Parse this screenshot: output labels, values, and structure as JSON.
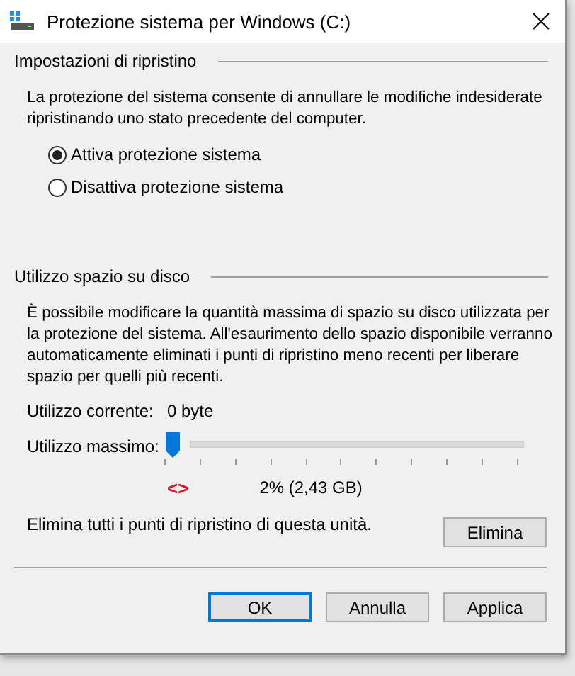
{
  "window": {
    "title": "Protezione sistema per Windows (C:)"
  },
  "restore_settings": {
    "heading": "Impostazioni di ripristino",
    "description": "La protezione del sistema consente di annullare le modifiche indesiderate ripristinando uno stato precedente del computer.",
    "options": [
      {
        "label": "Attiva protezione sistema",
        "selected": true
      },
      {
        "label": "Disattiva protezione sistema",
        "selected": false
      }
    ]
  },
  "disk_usage": {
    "heading": "Utilizzo spazio su disco",
    "description": "È possibile modificare la quantità massima di spazio su disco utilizzata per la protezione del sistema. All'esaurimento dello spazio disponibile verranno automaticamente eliminati i punti di ripristino meno recenti per liberare spazio per quelli più recenti.",
    "current_label": "Utilizzo corrente:",
    "current_value": "0 byte",
    "max_label": "Utilizzo massimo:",
    "max_usage": {
      "level": 0.02
    },
    "marker": "<>",
    "max_reading": "2% (2,43 GB)",
    "delete_text": "Elimina tutti i punti di ripristino di questa unità.",
    "delete_button": "Elimina"
  },
  "buttons": [
    {
      "label": "OK",
      "default": true
    },
    {
      "label": "Annulla",
      "default": false
    },
    {
      "label": "Applica",
      "default": false
    }
  ]
}
